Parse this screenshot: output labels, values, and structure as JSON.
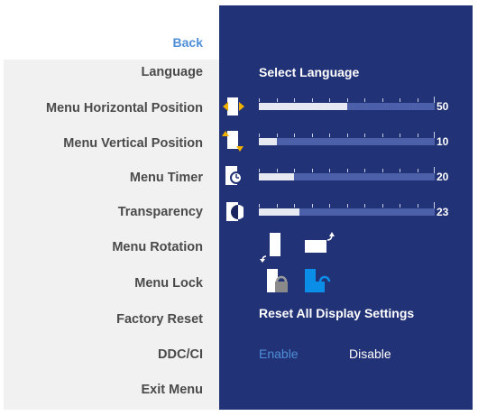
{
  "menu": {
    "back": "Back",
    "items": [
      "Language",
      "Menu Horizontal Position",
      "Menu Vertical Position",
      "Menu Timer",
      "Transparency",
      "Menu Rotation",
      "Menu Lock",
      "Factory Reset",
      "DDC/CI",
      "Exit Menu"
    ]
  },
  "settings": {
    "language": "Select Language",
    "horizontal_position": {
      "value": "50",
      "level": 0.5
    },
    "vertical_position": {
      "value": "10",
      "level": 0.1
    },
    "menu_timer": {
      "value": "20",
      "level": 0.2
    },
    "transparency": {
      "value": "23",
      "level": 0.23
    },
    "factory_reset": "Reset All Display Settings",
    "ddcci": {
      "enable": "Enable",
      "disable": "Disable"
    }
  },
  "colors": {
    "panel_bg": "#223276",
    "menu_bg": "#f1f1f1",
    "highlight": "#4f8ed8",
    "track": "#4b60a8",
    "fill": "#e6e8f2"
  }
}
